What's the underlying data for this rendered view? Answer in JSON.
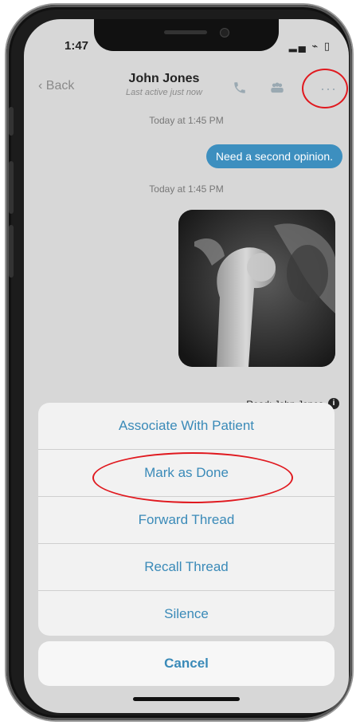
{
  "status": {
    "time": "1:47",
    "icons": "▂▄ ⌁ ▯"
  },
  "nav": {
    "back_label": "Back",
    "title": "John Jones",
    "subtitle": "Last active just now",
    "more_label": "···"
  },
  "messages": {
    "timestamp1": "Today at 1:45 PM",
    "bubble_text": "Need a second opinion.",
    "timestamp2": "Today at 1:45 PM",
    "read_receipt": "Read: John Jones"
  },
  "action_sheet": {
    "items": [
      {
        "label": "Associate With Patient"
      },
      {
        "label": "Mark as Done"
      },
      {
        "label": "Forward Thread"
      },
      {
        "label": "Recall Thread"
      },
      {
        "label": "Silence"
      }
    ],
    "cancel_label": "Cancel"
  },
  "colors": {
    "accent": "#3a8ab8",
    "bubble": "#3d8fbf",
    "highlight": "#e0191f"
  }
}
